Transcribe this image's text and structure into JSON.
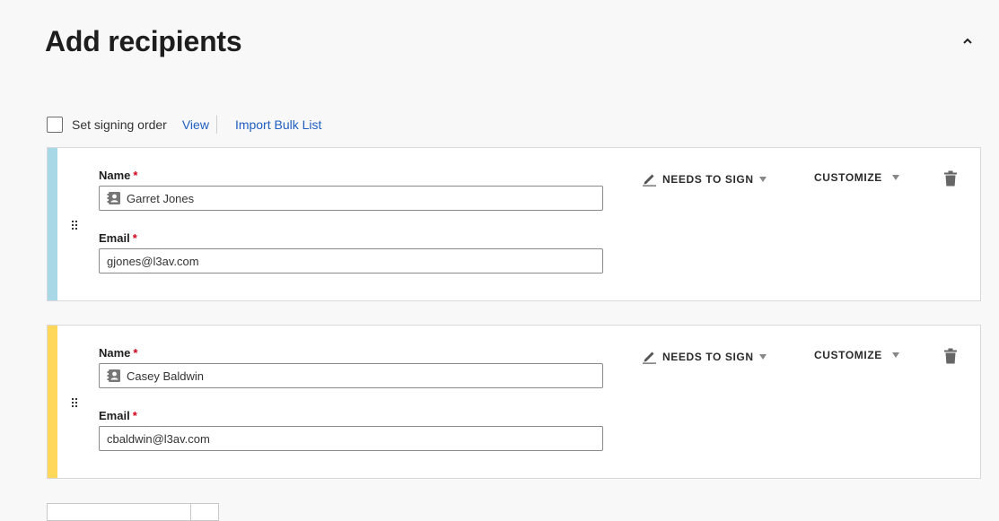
{
  "section": {
    "title": "Add recipients"
  },
  "options": {
    "signing_order_label": "Set signing order",
    "view_link": "View",
    "import_link": "Import Bulk List"
  },
  "recipients": [
    {
      "color": "#a8d8e6",
      "name_label": "Name",
      "name_value": "Garret Jones",
      "email_label": "Email",
      "email_value": "gjones@l3av.com",
      "required_mark": "*",
      "role": "NEEDS TO SIGN",
      "customize": "CUSTOMIZE"
    },
    {
      "color": "#ffd75a",
      "name_label": "Name",
      "name_value": "Casey Baldwin",
      "email_label": "Email",
      "email_value": "cbaldwin@l3av.com",
      "required_mark": "*",
      "role": "NEEDS TO SIGN",
      "customize": "CUSTOMIZE"
    }
  ],
  "icons": {
    "collapse": "chevron-up-icon",
    "contact": "contact-card-icon",
    "role": "pen-icon",
    "delete": "trash-icon",
    "drag": "drag-handle-icon"
  }
}
